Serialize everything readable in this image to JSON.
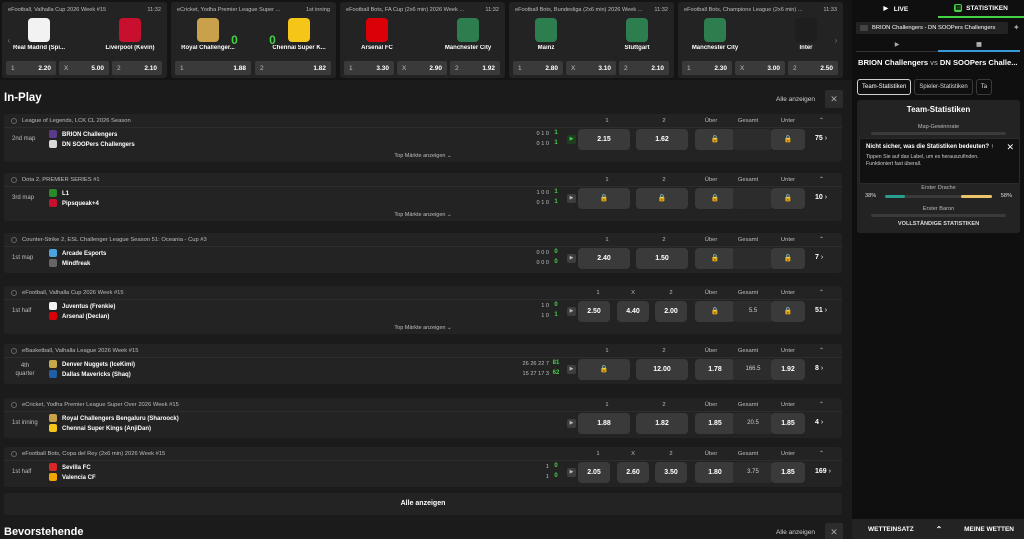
{
  "top_cards": [
    {
      "league": "eFootball, Valhalla Cup 2026 Week #15",
      "time": "11:32",
      "home": "Real Madrid (Spi...",
      "away": "Liverpool (Kevin)",
      "home_color": "#f2f2f2",
      "away_color": "#c8102e",
      "score": "",
      "odds": [
        {
          "k": "1",
          "v": "2.20"
        },
        {
          "k": "X",
          "v": "5.00"
        },
        {
          "k": "2",
          "v": "2.10"
        }
      ]
    },
    {
      "league": "eCricket, Yodha Premier League Super ...",
      "time": "1st inning",
      "home": "Royal Challenger...",
      "away": "Chennai Super K...",
      "home_color": "#c9a14a",
      "away_color": "#f5c518",
      "score": "0 0",
      "odds": [
        {
          "k": "1",
          "v": "1.88"
        },
        {
          "k": "2",
          "v": "1.82"
        }
      ]
    },
    {
      "league": "eFootball Bots, FA Cup (2x6 min) 2026 Week ...",
      "time": "11:32",
      "home": "Arsenal FC",
      "away": "Manchester City",
      "home_color": "#db0007",
      "away_color": "#2e7d4f",
      "score": "",
      "odds": [
        {
          "k": "1",
          "v": "3.30"
        },
        {
          "k": "X",
          "v": "2.90"
        },
        {
          "k": "2",
          "v": "1.92"
        }
      ]
    },
    {
      "league": "eFootball Bots, Bundesliga (2x6 min) 2026 Week ...",
      "time": "11:32",
      "home": "Mainz",
      "away": "Stuttgart",
      "home_color": "#2e7d4f",
      "away_color": "#2e7d4f",
      "score": "",
      "odds": [
        {
          "k": "1",
          "v": "2.80"
        },
        {
          "k": "X",
          "v": "3.10"
        },
        {
          "k": "2",
          "v": "2.10"
        }
      ]
    },
    {
      "league": "eFootball Bots, Champions League (2x6 min) ...",
      "time": "11:33",
      "home": "Manchester City",
      "away": "Inter",
      "home_color": "#2e7d4f",
      "away_color": "#1e1e1e",
      "score": "",
      "odds": [
        {
          "k": "1",
          "v": "2.30"
        },
        {
          "k": "X",
          "v": "3.00"
        },
        {
          "k": "2",
          "v": "2.50"
        }
      ]
    }
  ],
  "inplay_title": "In-Play",
  "show_all": "Alle anzeigen",
  "top_markets": "Top Märkte anzeigen",
  "all_button": "Alle anzeigen",
  "upcoming_title": "Bevorstehende",
  "events": [
    {
      "league": "League of Legends, LCK CL 2026 Season",
      "cols": [
        "1",
        "2",
        "Über",
        "Gesamt",
        "Unter"
      ],
      "period": "2nd map",
      "t1": "BRION Challengers",
      "t2": "DN SOOPers Challengers",
      "b1": "#5a3a8a",
      "b2": "#d9d9d9",
      "s1": "0  1  0",
      "s2": "0  1  0",
      "c1": "1",
      "c2": "1",
      "odds": [
        "2.15",
        "1.62",
        "lock",
        "",
        "lock"
      ],
      "more": "75",
      "live": true,
      "top": true
    },
    {
      "league": "Dota 2, PREMIER SERIES #1",
      "cols": [
        "1",
        "2",
        "Über",
        "Gesamt",
        "Unter"
      ],
      "period": "3rd map",
      "t1": "L1",
      "t2": "Pipsqueak+4",
      "b1": "#2a8a2a",
      "b2": "#c8102e",
      "s1": "1  0  0",
      "s2": "0  1  0",
      "c1": "1",
      "c2": "1",
      "odds": [
        "lock",
        "lock",
        "lock",
        "",
        "lock"
      ],
      "more": "10",
      "live": false,
      "top": true
    },
    {
      "league": "Counter-Strike 2, ESL Challenger League Season 51: Oceania - Cup #3",
      "cols": [
        "1",
        "2",
        "Über",
        "Gesamt",
        "Unter"
      ],
      "period": "1st map",
      "t1": "Arcade Esports",
      "t2": "Mindfreak",
      "b1": "#4aa3df",
      "b2": "#666666",
      "s1": "0  0  0",
      "s2": "0  0  0",
      "c1": "0",
      "c2": "0",
      "odds": [
        "2.40",
        "1.50",
        "lock",
        "",
        "lock"
      ],
      "more": "7",
      "live": false,
      "top": false
    },
    {
      "league": "eFootball, Valhalla Cup 2026 Week #15",
      "cols": [
        "1",
        "X",
        "2",
        "Über",
        "Gesamt",
        "Unter"
      ],
      "period": "1st half",
      "t1": "Juventus (Frenkie)",
      "t2": "Arsenal (Declan)",
      "b1": "#f2f2f2",
      "b2": "#db0007",
      "s1": "1  0",
      "s2": "1  0",
      "c1": "0",
      "c2": "1",
      "odds": [
        "2.50",
        "4.40",
        "2.00",
        "lock",
        "5.5",
        "lock"
      ],
      "more": "51",
      "live": false,
      "top": true
    },
    {
      "league": "eBasketball, Valhalla League 2026 Week #15",
      "cols": [
        "1",
        "2",
        "Über",
        "Gesamt",
        "Unter"
      ],
      "period": "4th quarter",
      "t1": "Denver Nuggets (IceKimi)",
      "t2": "Dallas Mavericks (Shaq)",
      "b1": "#c8a94a",
      "b2": "#1f5fa8",
      "s1": "26  26  22  7",
      "s2": "15  27  17  3",
      "c1": "81",
      "c2": "62",
      "odds": [
        "lock",
        "12.00",
        "1.78",
        "166.5",
        "1.92"
      ],
      "more": "8",
      "live": false,
      "top": false
    },
    {
      "league": "eCricket, Yodha Premier League Super Over 2026 Week #15",
      "cols": [
        "1",
        "2",
        "Über",
        "Gesamt",
        "Unter"
      ],
      "period": "1st inning",
      "t1": "Royal Challengers Bengaluru (Sharoock)",
      "t2": "Chennai Super Kings (AnjiDan)",
      "b1": "#c9a14a",
      "b2": "#f5c518",
      "s1": "",
      "s2": "",
      "c1": "",
      "c2": "",
      "odds": [
        "1.88",
        "1.82",
        "1.85",
        "20.5",
        "1.85"
      ],
      "more": "4",
      "live": false,
      "top": false
    },
    {
      "league": "eFootball Bots, Copa del Rey (2x6 min) 2026 Week #15",
      "cols": [
        "1",
        "X",
        "2",
        "Über",
        "Gesamt",
        "Unter"
      ],
      "period": "1st half",
      "t1": "Sevilla FC",
      "t2": "Valencia CF",
      "b1": "#d62828",
      "b2": "#f4a300",
      "s1": "1",
      "s2": "1",
      "c1": "0",
      "c2": "0",
      "odds": [
        "2.05",
        "2.60",
        "3.50",
        "1.80",
        "3.75",
        "1.85"
      ],
      "more": "169",
      "live": false,
      "top": false
    }
  ],
  "right": {
    "tab_live": "LIVE",
    "tab_stats": "STATISTIKEN",
    "match_select": "BRION Challengers - DN SOOPers Challengers",
    "subtab1": "▶",
    "subtab2": "▦",
    "home": "BRION Challengers",
    "vs": "vs",
    "away": "DN SOOPers Challe...",
    "pill1": "Team-Statistiken",
    "pill2": "Spieler-Statistiken",
    "pill3": "Ta",
    "stats_title": "Team-Statistiken",
    "map_wins": "Map-Gewinnrate",
    "popup_q": "Nicht sicher, was die Statistiken bedeuten? ↑",
    "popup_h": "Tippen Sie auf das Label, um es herauszufinden. Funktioniert fast überall.",
    "first_blood": "Erster Drache",
    "fb_left": "38%",
    "fb_right": "58%",
    "fb_left_share": 0.38,
    "fb_right_share": 0.58,
    "first_baron": "Erster Baron",
    "full_stats": "VOLLSTÄNDIGE STATISTIKEN",
    "betslip": "WETTEINSATZ",
    "my_bets": "MEINE WETTEN"
  }
}
